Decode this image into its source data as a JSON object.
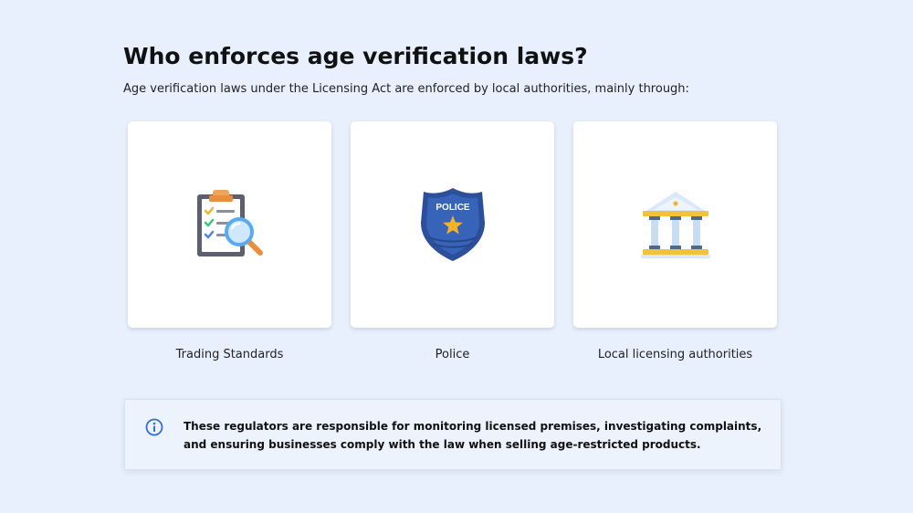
{
  "heading": {
    "title": "Who enforces age verification laws?",
    "subtitle": "Age verification laws under the Licensing Act are enforced by local authorities, mainly through:"
  },
  "cards": [
    {
      "label": "Trading Standards",
      "icon": "clipboard-magnifier-icon"
    },
    {
      "label": "Police",
      "icon": "police-badge-icon",
      "badge_text": "POLICE"
    },
    {
      "label": "Local licensing authorities",
      "icon": "government-building-icon"
    }
  ],
  "info": {
    "icon": "info-icon",
    "text": "These regulators are responsible for monitoring licensed premises, investigating complaints, and ensuring businesses comply with the law when selling age-restricted products."
  },
  "colors": {
    "background": "#e8f0fd",
    "card": "#ffffff",
    "info_box": "#edf3fd",
    "info_icon": "#2f6fd6",
    "badge_blue": "#2b4f9a",
    "star_gold": "#f2b22c"
  }
}
